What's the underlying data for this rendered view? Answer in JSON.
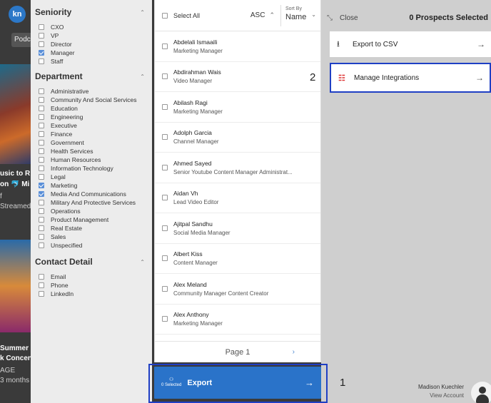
{
  "background": {
    "logo": "kn",
    "pod_tab": "Podc",
    "texts": [
      "usic to R",
      "on 🐬 Mi",
      "f",
      "Streamed",
      "Summer L",
      "k Concent",
      "AGE",
      "3 months"
    ]
  },
  "filters": {
    "sections": [
      {
        "title": "Seniority",
        "items": [
          {
            "label": "CXO",
            "checked": false
          },
          {
            "label": "VP",
            "checked": false
          },
          {
            "label": "Director",
            "checked": false
          },
          {
            "label": "Manager",
            "checked": true
          },
          {
            "label": "Staff",
            "checked": false
          }
        ]
      },
      {
        "title": "Department",
        "items": [
          {
            "label": "Administrative",
            "checked": false
          },
          {
            "label": "Community And Social Services",
            "checked": false
          },
          {
            "label": "Education",
            "checked": false
          },
          {
            "label": "Engineering",
            "checked": false
          },
          {
            "label": "Executive",
            "checked": false
          },
          {
            "label": "Finance",
            "checked": false
          },
          {
            "label": "Government",
            "checked": false
          },
          {
            "label": "Health Services",
            "checked": false
          },
          {
            "label": "Human Resources",
            "checked": false
          },
          {
            "label": "Information Technology",
            "checked": false
          },
          {
            "label": "Legal",
            "checked": false
          },
          {
            "label": "Marketing",
            "checked": true
          },
          {
            "label": "Media And Communications",
            "checked": true
          },
          {
            "label": "Military And Protective Services",
            "checked": false
          },
          {
            "label": "Operations",
            "checked": false
          },
          {
            "label": "Product Management",
            "checked": false
          },
          {
            "label": "Real Estate",
            "checked": false
          },
          {
            "label": "Sales",
            "checked": false
          },
          {
            "label": "Unspecified",
            "checked": false
          }
        ]
      },
      {
        "title": "Contact Detail",
        "items": [
          {
            "label": "Email",
            "checked": false
          },
          {
            "label": "Phone",
            "checked": false
          },
          {
            "label": "LinkedIn",
            "checked": false
          }
        ]
      }
    ]
  },
  "list": {
    "select_all": "Select All",
    "order": "ASC",
    "sort_by_label": "Sort By",
    "sort_by_value": "Name",
    "prospects": [
      {
        "name": "Abdelali Ismaaili",
        "title": "Marketing Manager"
      },
      {
        "name": "Abdirahman Wais",
        "title": "Video Manager"
      },
      {
        "name": "Abilash Ragi",
        "title": "Marketing Manager"
      },
      {
        "name": "Adolph Garcia",
        "title": "Channel Manager"
      },
      {
        "name": "Ahmed Sayed",
        "title": "Senior Youtube Content Manager Administrat..."
      },
      {
        "name": "Aidan Vh",
        "title": "Lead Video Editor"
      },
      {
        "name": "Ajitpal Sandhu",
        "title": "Social Media Manager"
      },
      {
        "name": "Albert Kiss",
        "title": "Content Manager"
      },
      {
        "name": "Alex Meland",
        "title": "Community Manager Content Creator"
      },
      {
        "name": "Alex Anthony",
        "title": "Marketing Manager"
      }
    ],
    "page_label": "Page 1"
  },
  "export": {
    "selected": "0 Selected",
    "label": "Export",
    "step_marker": "1"
  },
  "right_panel": {
    "close_label": "Close",
    "count_label": "0 Prospects Selected",
    "csv_label": "Export to CSV",
    "integrations_label": "Manage Integrations",
    "step_marker": "2"
  },
  "account": {
    "name": "Madison Kuechler",
    "view_label": "View Account"
  },
  "colors": {
    "accent": "#2a73c9",
    "highlight_frame": "#1f3fc4",
    "checkbox_on": "#5a8fd8",
    "integrations_icon": "#dd3333"
  }
}
